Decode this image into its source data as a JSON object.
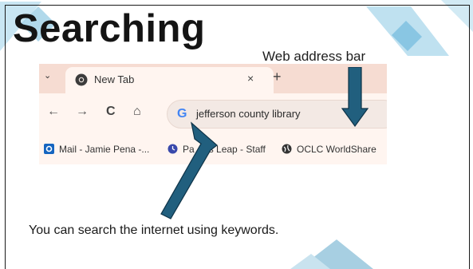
{
  "slide": {
    "title": "Searching",
    "callout": "Web address bar",
    "caption": "You can search the internet using keywords."
  },
  "browser": {
    "tab_menu": "⌄",
    "tab_title": "New Tab",
    "tab_close": "×",
    "new_tab": "+",
    "nav": {
      "back": "←",
      "forward": "→",
      "reload": "C",
      "home": "⌂"
    },
    "search_engine_letter": "G",
    "address_query": "jefferson county library",
    "bookmarks": [
      {
        "label": "Mail - Jamie Pena -...",
        "icon": "outlook-icon",
        "color": "#1565c0"
      },
      {
        "label": "Pa",
        "icon": "clock-icon",
        "color": "#3949ab"
      },
      {
        "label": "s Leap - Staff",
        "icon": "",
        "color": ""
      },
      {
        "label": "OCLC WorldShare",
        "icon": "globe-icon",
        "color": "#333333"
      }
    ]
  },
  "colors": {
    "arrow": "#215f7e",
    "arrow_outline": "#0d3247",
    "deco_light": "#bfe1f0",
    "deco_mid": "#9fcfe6",
    "deco_dark": "#8dbfd6"
  }
}
